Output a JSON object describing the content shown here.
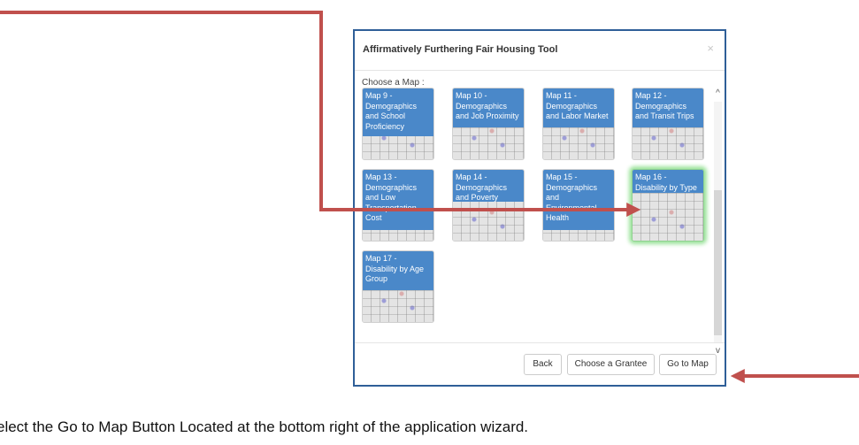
{
  "dialog": {
    "title": "Affirmatively Furthering Fair Housing Tool",
    "close_glyph": "×",
    "choose_label": "Choose a Map :",
    "maps": [
      {
        "label": "Map 9 - Demographics and School Proficiency",
        "selected": false
      },
      {
        "label": "Map 10 - Demographics and Job Proximity",
        "selected": false
      },
      {
        "label": "Map 11 - Demographics and Labor Market",
        "selected": false
      },
      {
        "label": "Map 12 - Demographics and Transit Trips",
        "selected": false
      },
      {
        "label": "Map 13 - Demographics and Low Transportation Cost",
        "selected": false
      },
      {
        "label": "Map 14 - Demographics and Poverty",
        "selected": false
      },
      {
        "label": "Map 15 - Demographics and Environmental Health",
        "selected": false
      },
      {
        "label": "Map 16 - Disability by Type",
        "selected": true
      },
      {
        "label": "Map 17 - Disability by Age Group",
        "selected": false
      }
    ],
    "scroll_up_glyph": "^",
    "scroll_down_glyph": "v",
    "footer": {
      "back_label": "Back",
      "grantee_label": "Choose a Grantee",
      "go_label": "Go to Map"
    }
  },
  "caption": "elect the Go to Map Button Located at the bottom right of the application wizard.",
  "colors": {
    "tile_label_bg": "#4a88c9",
    "arrow": "#c0504d",
    "dialog_border": "#2f5f98",
    "selected_glow": "#9be39b"
  }
}
